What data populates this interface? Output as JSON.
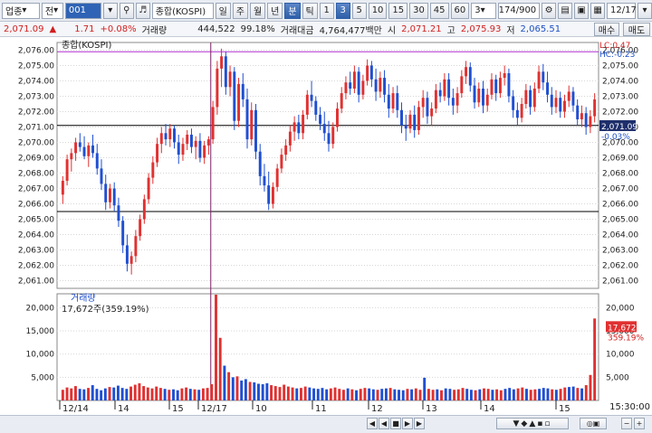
{
  "toolbar": {
    "market_select": "업종",
    "mode_select": "전",
    "code": "001",
    "name": "종합(KOSPI)",
    "period_tabs": [
      "일",
      "주",
      "월",
      "년",
      "분",
      "틱"
    ],
    "active_period": "분",
    "interval_buttons": [
      "1",
      "3",
      "5",
      "10",
      "15",
      "30",
      "45",
      "60"
    ],
    "active_interval": "3",
    "interval_value": "3",
    "count": "174/900",
    "date": "12/17"
  },
  "quote": {
    "price": "2,071.09",
    "change": "1.71",
    "change_pct": "+0.08%",
    "volume_label": "거래량",
    "volume": "444,522",
    "volume_ratio": "99.18%",
    "amount_label": "거래대금",
    "amount": "4,764,477백만",
    "open_label": "시",
    "open": "2,071.21",
    "high_label": "고",
    "high": "2,075.93",
    "low_label": "저",
    "low": "2,065.51",
    "buy": "매수",
    "sell": "매도"
  },
  "chart_data": {
    "type": "candlestick",
    "price_panel": {
      "legend": "종합(KOSPI)",
      "ylim": [
        2060.5,
        2076.5
      ],
      "yticks": [
        "2,076.00",
        "2,075.00",
        "2,074.00",
        "2,073.00",
        "2,072.00",
        "2,071.00",
        "2,070.00",
        "2,069.00",
        "2,068.00",
        "2,067.00",
        "2,066.00",
        "2,065.00",
        "2,064.00",
        "2,063.00",
        "2,062.00",
        "2,061.00"
      ],
      "current_label": "2,071.09",
      "current_pct": "-0.03%",
      "lc": "LC:0.47",
      "hc": "HC:-0.23",
      "hlines": [
        2075.9,
        2071.1,
        2065.5
      ]
    },
    "volume_panel": {
      "legend": "거래량",
      "value_text": "17,672주(359.19%)",
      "ylim": [
        0,
        23000
      ],
      "yticks": [
        "20,000",
        "15,000",
        "10,000",
        "5,000"
      ],
      "current_label": "17,672",
      "current_pct": "359.19%"
    },
    "x_labels": [
      "12/14",
      "14",
      "15",
      "12/17",
      "10",
      "11",
      "12",
      "13",
      "14",
      "15"
    ],
    "time_label": "15:30:00",
    "candles": [
      [
        2066.6,
        2067.8,
        2066.0,
        2067.5
      ],
      [
        2067.5,
        2069.2,
        2067.2,
        2068.9
      ],
      [
        2068.9,
        2069.6,
        2068.1,
        2069.3
      ],
      [
        2069.3,
        2070.3,
        2068.8,
        2070.0
      ],
      [
        2070.0,
        2070.6,
        2069.4,
        2069.7
      ],
      [
        2069.7,
        2070.4,
        2068.9,
        2069.1
      ],
      [
        2069.1,
        2070.0,
        2068.4,
        2069.8
      ],
      [
        2069.8,
        2070.5,
        2069.0,
        2069.3
      ],
      [
        2069.3,
        2069.9,
        2067.9,
        2068.3
      ],
      [
        2068.3,
        2068.9,
        2066.9,
        2067.3
      ],
      [
        2067.3,
        2067.9,
        2065.6,
        2066.1
      ],
      [
        2066.1,
        2067.3,
        2065.7,
        2067.0
      ],
      [
        2067.0,
        2067.4,
        2065.5,
        2065.9
      ],
      [
        2065.9,
        2066.4,
        2064.5,
        2064.9
      ],
      [
        2064.9,
        2065.2,
        2062.8,
        2063.3
      ],
      [
        2063.3,
        2064.0,
        2061.6,
        2062.1
      ],
      [
        2062.1,
        2062.9,
        2061.4,
        2062.6
      ],
      [
        2062.6,
        2064.3,
        2062.2,
        2063.9
      ],
      [
        2063.9,
        2065.3,
        2063.6,
        2065.0
      ],
      [
        2065.0,
        2066.6,
        2064.7,
        2066.3
      ],
      [
        2066.3,
        2068.0,
        2066.0,
        2067.7
      ],
      [
        2067.7,
        2069.1,
        2067.3,
        2068.7
      ],
      [
        2068.7,
        2070.3,
        2068.4,
        2069.9
      ],
      [
        2069.9,
        2071.0,
        2069.3,
        2070.6
      ],
      [
        2070.6,
        2071.2,
        2069.8,
        2070.2
      ],
      [
        2070.2,
        2071.2,
        2069.7,
        2070.9
      ],
      [
        2070.9,
        2071.1,
        2069.6,
        2070.0
      ],
      [
        2070.0,
        2070.5,
        2068.6,
        2069.2
      ],
      [
        2069.2,
        2070.3,
        2068.8,
        2069.9
      ],
      [
        2069.9,
        2070.8,
        2069.5,
        2070.5
      ],
      [
        2070.5,
        2070.9,
        2069.3,
        2069.7
      ],
      [
        2069.7,
        2070.4,
        2068.9,
        2070.1
      ],
      [
        2070.1,
        2070.6,
        2068.7,
        2069.0
      ],
      [
        2069.0,
        2070.1,
        2068.6,
        2069.8
      ],
      [
        2069.8,
        2070.4,
        2069.2,
        2070.2
      ],
      [
        2070.2,
        2072.7,
        2069.9,
        2072.3
      ],
      [
        2072.3,
        2075.3,
        2071.8,
        2074.8
      ],
      [
        2074.8,
        2076.1,
        2073.6,
        2075.6
      ],
      [
        2075.6,
        2075.9,
        2073.1,
        2073.6
      ],
      [
        2073.6,
        2075.0,
        2073.0,
        2074.6
      ],
      [
        2074.6,
        2074.9,
        2070.8,
        2071.4
      ],
      [
        2071.4,
        2074.2,
        2071.0,
        2073.8
      ],
      [
        2073.8,
        2074.5,
        2072.3,
        2072.8
      ],
      [
        2072.8,
        2073.5,
        2069.6,
        2070.2
      ],
      [
        2070.2,
        2072.6,
        2069.8,
        2072.1
      ],
      [
        2072.1,
        2072.5,
        2068.9,
        2069.4
      ],
      [
        2069.4,
        2069.9,
        2067.2,
        2067.8
      ],
      [
        2067.8,
        2068.6,
        2066.8,
        2067.2
      ],
      [
        2067.2,
        2068.1,
        2065.6,
        2066.0
      ],
      [
        2066.0,
        2067.4,
        2065.7,
        2067.1
      ],
      [
        2067.1,
        2068.6,
        2066.8,
        2068.3
      ],
      [
        2068.3,
        2069.6,
        2068.0,
        2069.2
      ],
      [
        2069.2,
        2070.2,
        2068.8,
        2069.8
      ],
      [
        2069.8,
        2071.1,
        2069.4,
        2070.7
      ],
      [
        2070.7,
        2071.7,
        2070.1,
        2071.3
      ],
      [
        2071.3,
        2071.8,
        2070.2,
        2070.6
      ],
      [
        2070.6,
        2072.1,
        2070.2,
        2071.8
      ],
      [
        2071.8,
        2073.4,
        2071.5,
        2073.1
      ],
      [
        2073.1,
        2074.0,
        2072.3,
        2072.7
      ],
      [
        2072.7,
        2073.0,
        2071.4,
        2071.8
      ],
      [
        2071.8,
        2072.3,
        2070.8,
        2071.2
      ],
      [
        2071.2,
        2072.0,
        2070.1,
        2070.6
      ],
      [
        2070.6,
        2071.4,
        2069.4,
        2069.9
      ],
      [
        2069.9,
        2071.3,
        2069.6,
        2071.0
      ],
      [
        2071.0,
        2072.6,
        2070.7,
        2072.2
      ],
      [
        2072.2,
        2073.6,
        2071.9,
        2073.2
      ],
      [
        2073.2,
        2074.3,
        2072.8,
        2073.9
      ],
      [
        2073.9,
        2074.6,
        2073.1,
        2073.5
      ],
      [
        2073.5,
        2075.0,
        2073.2,
        2074.6
      ],
      [
        2074.6,
        2074.9,
        2072.6,
        2073.1
      ],
      [
        2073.1,
        2074.4,
        2072.8,
        2074.0
      ],
      [
        2074.0,
        2075.4,
        2073.7,
        2075.0
      ],
      [
        2075.0,
        2075.3,
        2073.6,
        2074.1
      ],
      [
        2074.1,
        2074.8,
        2072.7,
        2073.3
      ],
      [
        2073.3,
        2074.6,
        2072.9,
        2074.2
      ],
      [
        2074.2,
        2074.7,
        2072.6,
        2073.1
      ],
      [
        2073.1,
        2073.8,
        2071.6,
        2072.2
      ],
      [
        2072.2,
        2073.6,
        2071.9,
        2073.2
      ],
      [
        2073.2,
        2073.7,
        2071.6,
        2072.1
      ],
      [
        2072.1,
        2072.6,
        2070.6,
        2071.1
      ],
      [
        2071.1,
        2071.8,
        2070.1,
        2070.9
      ],
      [
        2070.9,
        2072.1,
        2070.6,
        2071.8
      ],
      [
        2071.8,
        2072.4,
        2070.3,
        2070.8
      ],
      [
        2070.8,
        2072.7,
        2070.5,
        2072.3
      ],
      [
        2072.3,
        2073.4,
        2071.6,
        2072.9
      ],
      [
        2072.9,
        2073.3,
        2071.2,
        2071.7
      ],
      [
        2071.7,
        2072.6,
        2071.1,
        2072.2
      ],
      [
        2072.2,
        2073.8,
        2071.9,
        2073.4
      ],
      [
        2073.4,
        2073.9,
        2072.6,
        2073.0
      ],
      [
        2073.0,
        2074.5,
        2072.7,
        2074.1
      ],
      [
        2074.1,
        2074.5,
        2072.4,
        2072.9
      ],
      [
        2072.9,
        2073.5,
        2071.8,
        2072.4
      ],
      [
        2072.4,
        2073.6,
        2071.9,
        2073.2
      ],
      [
        2073.2,
        2074.7,
        2072.9,
        2074.3
      ],
      [
        2074.3,
        2075.3,
        2073.8,
        2074.9
      ],
      [
        2074.9,
        2075.2,
        2073.3,
        2073.7
      ],
      [
        2073.7,
        2074.2,
        2072.2,
        2072.6
      ],
      [
        2072.6,
        2073.9,
        2072.3,
        2073.5
      ],
      [
        2073.5,
        2074.0,
        2071.9,
        2072.4
      ],
      [
        2072.4,
        2073.5,
        2072.0,
        2073.1
      ],
      [
        2073.1,
        2074.5,
        2072.8,
        2074.1
      ],
      [
        2074.1,
        2074.4,
        2072.7,
        2073.2
      ],
      [
        2073.2,
        2074.6,
        2072.9,
        2074.2
      ],
      [
        2074.2,
        2075.0,
        2073.7,
        2074.5
      ],
      [
        2074.5,
        2074.8,
        2072.6,
        2073.0
      ],
      [
        2073.0,
        2073.4,
        2071.6,
        2072.1
      ],
      [
        2072.1,
        2072.6,
        2071.1,
        2071.6
      ],
      [
        2071.6,
        2072.9,
        2071.3,
        2072.5
      ],
      [
        2072.5,
        2073.8,
        2072.2,
        2073.4
      ],
      [
        2073.4,
        2073.7,
        2071.8,
        2072.3
      ],
      [
        2072.3,
        2073.9,
        2072.0,
        2073.5
      ],
      [
        2073.5,
        2075.0,
        2073.2,
        2074.6
      ],
      [
        2074.6,
        2075.1,
        2073.4,
        2073.9
      ],
      [
        2073.9,
        2074.6,
        2072.6,
        2073.1
      ],
      [
        2073.1,
        2073.6,
        2071.8,
        2072.3
      ],
      [
        2072.3,
        2073.4,
        2071.9,
        2072.9
      ],
      [
        2072.9,
        2073.3,
        2071.6,
        2072.0
      ],
      [
        2072.0,
        2073.1,
        2071.6,
        2072.7
      ],
      [
        2072.7,
        2073.7,
        2072.3,
        2073.3
      ],
      [
        2073.3,
        2073.6,
        2072.0,
        2072.4
      ],
      [
        2072.4,
        2072.8,
        2071.1,
        2071.5
      ],
      [
        2071.5,
        2072.4,
        2071.0,
        2071.9
      ],
      [
        2071.9,
        2072.3,
        2070.5,
        2071.0
      ],
      [
        2071.0,
        2072.1,
        2070.6,
        2071.7
      ],
      [
        2071.7,
        2073.2,
        2071.3,
        2072.8
      ]
    ],
    "volumes": [
      2300,
      2800,
      2600,
      3100,
      2500,
      2400,
      2700,
      3300,
      2500,
      2200,
      2600,
      2900,
      2800,
      3200,
      2700,
      2500,
      3000,
      3400,
      3700,
      3100,
      2800,
      2600,
      3000,
      2700,
      2500,
      2300,
      2400,
      2200,
      2600,
      2800,
      2500,
      2400,
      2300,
      2600,
      2700,
      3500,
      22800,
      13500,
      7500,
      6100,
      5000,
      5200,
      4300,
      4600,
      4000,
      3900,
      3600,
      3500,
      3700,
      3300,
      3100,
      2900,
      3400,
      3000,
      2800,
      2600,
      2700,
      3000,
      2800,
      2600,
      2500,
      2700,
      2400,
      2600,
      2800,
      2500,
      2300,
      2600,
      2400,
      2200,
      2500,
      2700,
      2600,
      2400,
      2300,
      2500,
      2600,
      2700,
      2400,
      2300,
      2200,
      2500,
      2400,
      2600,
      2300,
      4900,
      2500,
      2300,
      2400,
      2200,
      2600,
      2500,
      2300,
      2400,
      2700,
      2500,
      2300,
      2200,
      2400,
      2600,
      2500,
      2300,
      2400,
      2200,
      2500,
      2700,
      2400,
      2600,
      2800,
      2500,
      2300,
      2400,
      2500,
      2700,
      2600,
      2400,
      2300,
      2500,
      2800,
      2900,
      3000,
      2700,
      2600,
      3300,
      5500,
      17672
    ]
  },
  "colors": {
    "up": "#e03131",
    "down": "#1f4fd1",
    "grid": "#d7d7d7",
    "hline_purple": "#b02fd1",
    "hline_black": "#000000",
    "vline": "#7a1f63"
  },
  "status": {
    "page_index": "1"
  }
}
